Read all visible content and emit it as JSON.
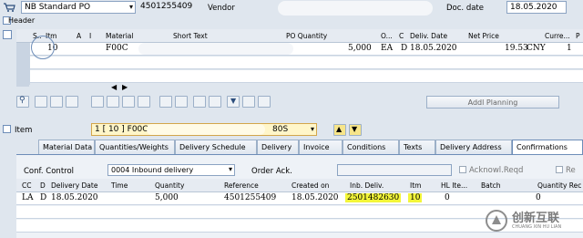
{
  "header_bar": {
    "doc_type": "NB Standard PO",
    "po_number": "4501255409",
    "vendor_label": "Vendor",
    "doc_date_label": "Doc. date",
    "doc_date": "18.05.2020"
  },
  "header_section": {
    "label": "Header"
  },
  "items_table": {
    "columns": [
      "S..",
      "Itm",
      "A",
      "I",
      "Material",
      "Short Text",
      "PO Quantity",
      "O...",
      "C",
      "Deliv. Date",
      "Net Price",
      "Curre...",
      "P"
    ],
    "rows": [
      {
        "itm": "10",
        "material": "F00C",
        "qty": "5,000",
        "unit": "EA",
        "c": "D",
        "date": "18.05.2020",
        "price": "19.53",
        "curr": "CNY",
        "p": "1"
      }
    ]
  },
  "toolbar": {
    "addl_planning": "Addl Planning"
  },
  "item_section": {
    "label": "Item",
    "selector_value": "1 [ 10 ] F00C",
    "selector_suffix": "80S"
  },
  "tabs": [
    {
      "label": "Material Data"
    },
    {
      "label": "Quantities/Weights"
    },
    {
      "label": "Delivery Schedule"
    },
    {
      "label": "Delivery"
    },
    {
      "label": "Invoice"
    },
    {
      "label": "Conditions"
    },
    {
      "label": "Texts"
    },
    {
      "label": "Delivery Address"
    },
    {
      "label": "Confirmations"
    }
  ],
  "confirmations": {
    "conf_control_label": "Conf. Control",
    "conf_control_value": "0004 Inbound delivery",
    "order_ack_label": "Order Ack.",
    "acknowl_reqd_label": "Acknowl.Reqd",
    "re_label": "Re",
    "columns": [
      "CC",
      "D",
      "Delivery Date",
      "Time",
      "Quantity",
      "Reference",
      "Created on",
      "Inb. Deliv.",
      "Itm",
      "HL Ite...",
      "Batch",
      "Quantity Rec"
    ],
    "rows": [
      {
        "cc": "LA",
        "d": "D",
        "date": "18.05.2020",
        "time": "",
        "qty": "5,000",
        "reference": "4501255409",
        "created": "18.05.2020",
        "inb": "2501482630",
        "itm": "10",
        "hl": "0",
        "batch": "",
        "qtyrec": "0"
      }
    ]
  },
  "watermark": {
    "text": "创新互联",
    "subtext": "CHUANG XIN HU LIAN"
  },
  "colors": {
    "highlight": "#f3f63a",
    "background": "#dfe6ee",
    "header": "#e6ebf2"
  }
}
